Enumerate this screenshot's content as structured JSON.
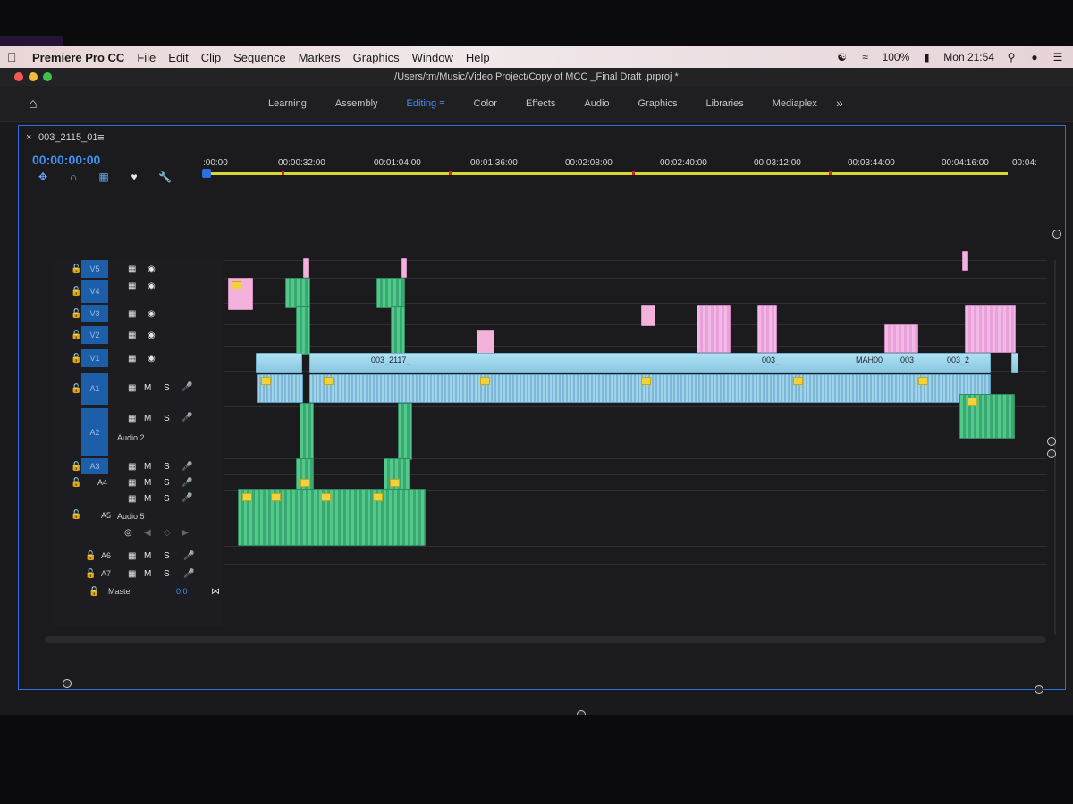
{
  "menubar": {
    "app_name": "Premiere Pro CC",
    "items": [
      "File",
      "Edit",
      "Clip",
      "Sequence",
      "Markers",
      "Graphics",
      "Window",
      "Help"
    ],
    "battery": "100%",
    "clock": "Mon 21:54",
    "icons": [
      "creative-cloud-icon",
      "wifi-icon",
      "battery-icon",
      "search-icon",
      "user-icon",
      "list-icon"
    ]
  },
  "window": {
    "title": "/Users/tm/Music/Video Project/Copy of MCC _Final Draft .prproj *"
  },
  "workspace": {
    "tabs": [
      {
        "label": "Learning",
        "active": false
      },
      {
        "label": "Assembly",
        "active": false
      },
      {
        "label": "Editing",
        "active": true
      },
      {
        "label": "Color",
        "active": false
      },
      {
        "label": "Effects",
        "active": false
      },
      {
        "label": "Audio",
        "active": false
      },
      {
        "label": "Graphics",
        "active": false
      },
      {
        "label": "Libraries",
        "active": false
      },
      {
        "label": "Mediaplex",
        "active": false
      }
    ],
    "more": "»"
  },
  "timeline": {
    "sequence_name": "003_2115_01",
    "timecode": "00:00:00:00",
    "ruler": [
      ":00:00",
      "00:00:32:00",
      "00:01:04:00",
      "00:01:36:00",
      "00:02:08:00",
      "00:02:40:00",
      "00:03:12:00",
      "00:03:44:00",
      "00:04:16:00",
      "00:04:"
    ],
    "video_tracks": [
      "V5",
      "V4",
      "V3",
      "V2",
      "V1"
    ],
    "audio_tracks": [
      {
        "name": "A1",
        "label": ""
      },
      {
        "name": "A2",
        "label": "Audio 2"
      },
      {
        "name": "A3",
        "label": ""
      },
      {
        "name": "A4",
        "label": ""
      },
      {
        "name": "A5",
        "label": "Audio 5"
      },
      {
        "name": "A6",
        "label": ""
      },
      {
        "name": "A7",
        "label": ""
      }
    ],
    "track_buttons": {
      "mute": "M",
      "solo": "S"
    },
    "master_label": "Master",
    "master_value": "0.0",
    "clip_labels": [
      "003_2117_",
      "003_",
      "MAH00",
      "003",
      "003_2"
    ]
  },
  "colors": {
    "accent": "#3f8ff5",
    "video_clip": "#aee2f2",
    "audio_clip": "#9fd3ea",
    "graphic_clip": "#52c98a",
    "title_clip": "#f2b8e6",
    "timeline_bar": "#d8d830"
  }
}
